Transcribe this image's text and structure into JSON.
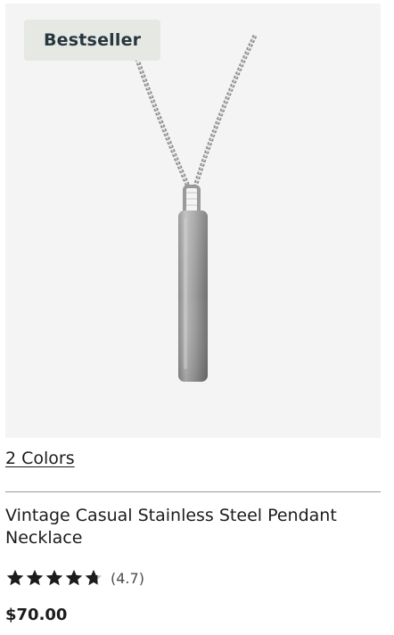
{
  "product": {
    "badge": "Bestseller",
    "colors_link": "2 Colors",
    "name": "Vintage Casual Stainless Steel Pendant Necklace",
    "rating_text": "(4.7)",
    "rating": 4.7,
    "rating_max": 5,
    "price": "$70.00"
  },
  "colors": {
    "image_background": "#f4f4f4",
    "badge_background": "#e6e8e3",
    "badge_text": "#27373f",
    "star_filled": "#1c1c1c",
    "star_empty": "#c4c4c4"
  },
  "icons": {
    "product_image": "pendant-necklace-image",
    "star": "star-icon"
  }
}
